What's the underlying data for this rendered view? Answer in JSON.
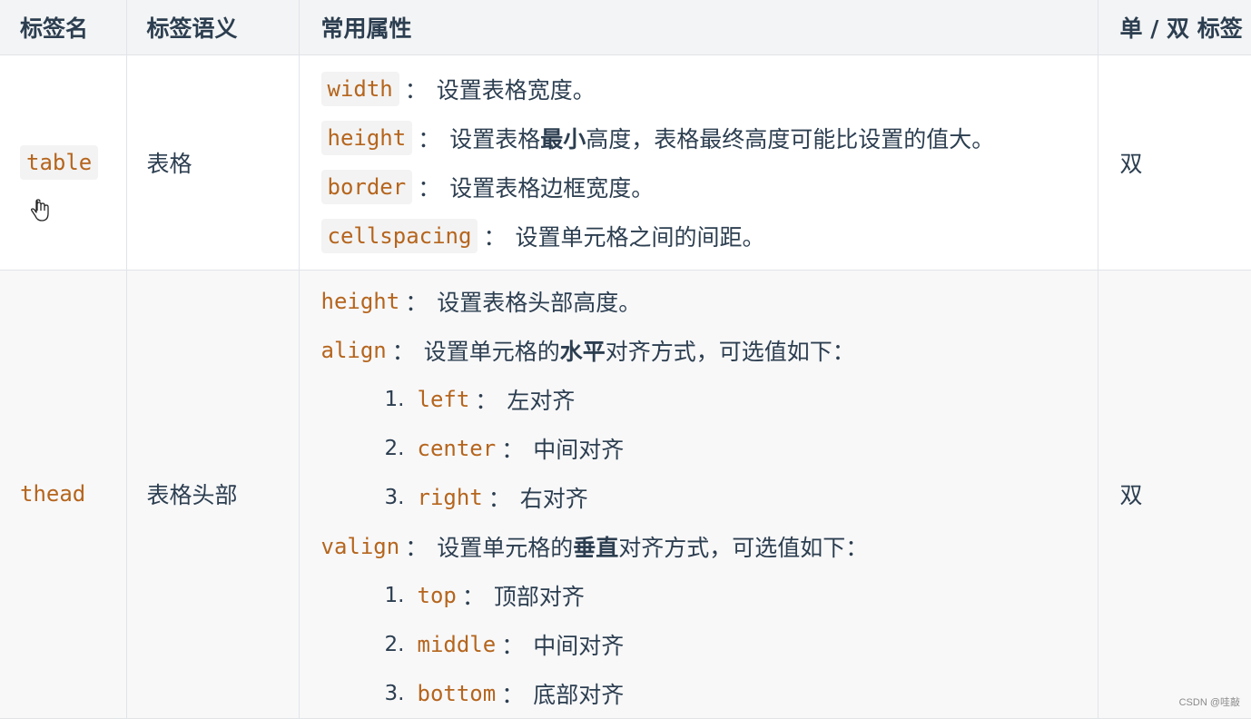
{
  "table": {
    "headers": [
      "标签名",
      "标签语义",
      "常用属性",
      "单 / 双 标签"
    ],
    "rows": [
      {
        "tag": "table",
        "semantic": "表格",
        "pair": "双",
        "attrs": [
          {
            "name": "width",
            "pre": "设置表格宽度。",
            "bold": "",
            "post": ""
          },
          {
            "name": "height",
            "pre": "设置表格",
            "bold": "最小",
            "post": "高度，表格最终高度可能比设置的值大。"
          },
          {
            "name": "border",
            "pre": "设置表格边框宽度。",
            "bold": "",
            "post": ""
          },
          {
            "name": "cellspacing",
            "pre": "设置单元格之间的间距。",
            "bold": "",
            "post": ""
          }
        ]
      },
      {
        "tag": "thead",
        "semantic": "表格头部",
        "pair": "双",
        "attrs": [
          {
            "name": "height",
            "pre": "设置表格头部高度。",
            "bold": "",
            "post": ""
          },
          {
            "name": "align",
            "pre": "设置单元格的",
            "bold": "水平",
            "post": "对齐方式，可选值如下：",
            "options": [
              {
                "num": "1.",
                "value": "left",
                "desc": "左对齐"
              },
              {
                "num": "2.",
                "value": "center",
                "desc": "中间对齐"
              },
              {
                "num": "3.",
                "value": "right",
                "desc": "右对齐"
              }
            ]
          },
          {
            "name": "valign",
            "pre": "设置单元格的",
            "bold": "垂直",
            "post": "对齐方式，可选值如下：",
            "options": [
              {
                "num": "1.",
                "value": "top",
                "desc": "顶部对齐"
              },
              {
                "num": "2.",
                "value": "middle",
                "desc": "中间对齐"
              },
              {
                "num": "3.",
                "value": "bottom",
                "desc": "底部对齐"
              }
            ]
          }
        ]
      }
    ]
  },
  "separator": "：",
  "watermark": "CSDN @哇敲",
  "colors": {
    "code_text": "#b5651d",
    "header_bg": "#f3f4f5",
    "text": "#2c3e50"
  }
}
